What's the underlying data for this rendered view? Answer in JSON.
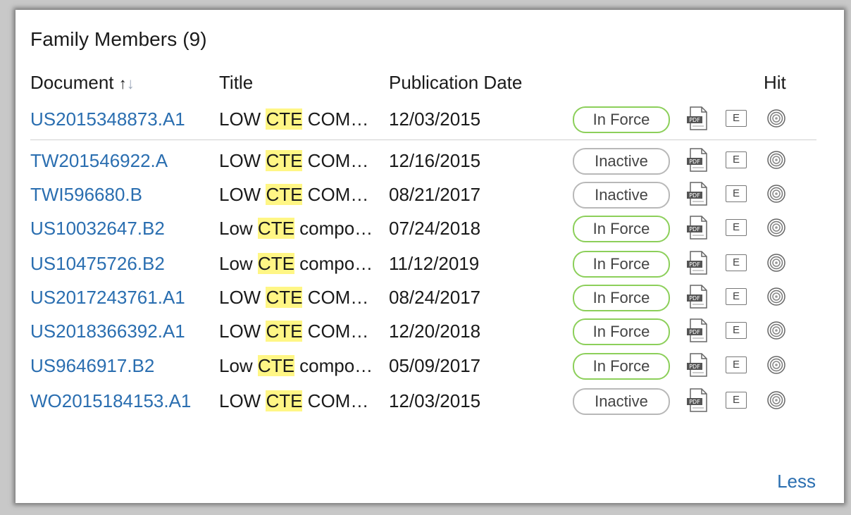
{
  "panel": {
    "title": "Family Members (9)",
    "less_label": "Less"
  },
  "columns": {
    "document": "Document",
    "sort_up": "↑",
    "sort_down": "↓",
    "title": "Title",
    "publication_date": "Publication Date",
    "hit": "Hit"
  },
  "rows": [
    {
      "document": "US2015348873.A1",
      "title_pre": "LOW ",
      "title_hl": "CTE",
      "title_post": " COM…",
      "date": "12/03/2015",
      "status": "In Force"
    },
    {
      "document": "TW201546922.A",
      "title_pre": "LOW ",
      "title_hl": "CTE",
      "title_post": " COM…",
      "date": "12/16/2015",
      "status": "Inactive"
    },
    {
      "document": "TWI596680.B",
      "title_pre": "LOW ",
      "title_hl": "CTE",
      "title_post": " COM…",
      "date": "08/21/2017",
      "status": "Inactive"
    },
    {
      "document": "US10032647.B2",
      "title_pre": "Low ",
      "title_hl": "CTE",
      "title_post": " compo…",
      "date": "07/24/2018",
      "status": "In Force"
    },
    {
      "document": "US10475726.B2",
      "title_pre": "Low ",
      "title_hl": "CTE",
      "title_post": " compo…",
      "date": "11/12/2019",
      "status": "In Force"
    },
    {
      "document": "US2017243761.A1",
      "title_pre": "LOW ",
      "title_hl": "CTE",
      "title_post": " COM…",
      "date": "08/24/2017",
      "status": "In Force"
    },
    {
      "document": "US2018366392.A1",
      "title_pre": "LOW ",
      "title_hl": "CTE",
      "title_post": " COM…",
      "date": "12/20/2018",
      "status": "In Force"
    },
    {
      "document": "US9646917.B2",
      "title_pre": "Low ",
      "title_hl": "CTE",
      "title_post": " compo…",
      "date": "05/09/2017",
      "status": "In Force"
    },
    {
      "document": "WO2015184153.A1",
      "title_pre": "LOW ",
      "title_hl": "CTE",
      "title_post": " COM…",
      "date": "12/03/2015",
      "status": "Inactive"
    }
  ],
  "icons": {
    "pdf": "pdf-icon",
    "pdf_text": "PDF",
    "extended": "e-icon",
    "extended_text": "E",
    "hit": "hit-target-icon"
  },
  "colors": {
    "link": "#2a6eb0",
    "highlight": "#fff685",
    "in_force_border": "#8ccf5a",
    "inactive_border": "#b8b8b8"
  }
}
